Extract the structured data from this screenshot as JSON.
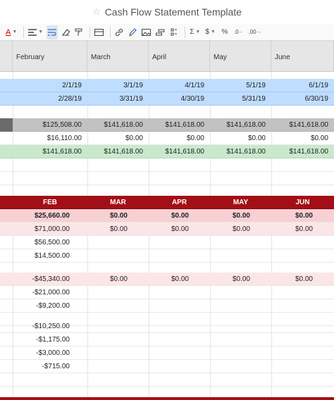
{
  "window": {
    "title": "Cash Flow Statement Template"
  },
  "toolbar": {
    "font_color": "A",
    "sum": "Σ",
    "currency": "$",
    "percent": "%",
    "decrease_decimals": ".0",
    "increase_decimals": ".00"
  },
  "columns": [
    "February",
    "March",
    "April",
    "May",
    "June"
  ],
  "periods": {
    "start": [
      "2/1/19",
      "3/1/19",
      "4/1/19",
      "5/1/19",
      "6/1/19"
    ],
    "end": [
      "2/28/19",
      "3/31/19",
      "4/30/19",
      "5/31/19",
      "6/30/19"
    ]
  },
  "summary": {
    "gray": [
      "$125,508.00",
      "$141,618.00",
      "$141,618.00",
      "$141,618.00",
      "$141,618.00"
    ],
    "white": [
      "$16,110.00",
      "$0.00",
      "$0.00",
      "$0.00",
      "$0.00"
    ],
    "green": [
      "$141,618.00",
      "$141,618.00",
      "$141,618.00",
      "$141,618.00",
      "$141,618.00"
    ]
  },
  "section": {
    "months": [
      "FEB",
      "MAR",
      "APR",
      "MAY",
      "JUN"
    ],
    "total": [
      "$25,660.00",
      "$0.00",
      "$0.00",
      "$0.00",
      "$0.00"
    ],
    "receipts_total": [
      "$71,000.00",
      "$0.00",
      "$0.00",
      "$0.00",
      "$0.00"
    ],
    "receipt_items": [
      "$56,500.00",
      "$14,500.00"
    ],
    "payments_total": [
      "-$45,340.00",
      "$0.00",
      "$0.00",
      "$0.00",
      "$0.00"
    ],
    "payment_items_a": [
      "-$21,000.00",
      "-$9,200.00"
    ],
    "payment_items_b": [
      "-$10,250.00",
      "-$1,175.00",
      "-$3,000.00",
      "-$715.00"
    ]
  },
  "colors": {
    "accent_red": "#a30f16",
    "blue_row": "#bfddff",
    "green_row": "#c9e9cd",
    "gray_row": "#c2c2c2",
    "pink_row": "#f6d0d3"
  }
}
